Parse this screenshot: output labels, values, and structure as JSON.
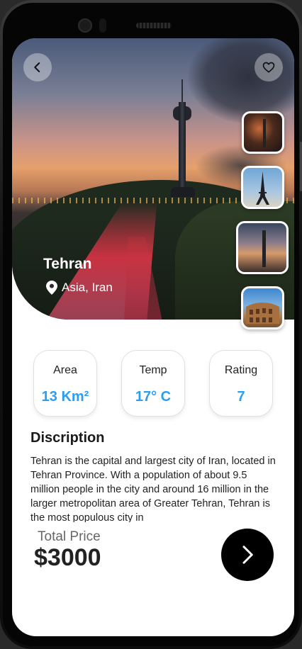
{
  "destination": {
    "name": "Tehran",
    "location": "Asia, Iran"
  },
  "header": {
    "back_icon": "chevron-left-icon",
    "favorite_icon": "heart-outline-icon"
  },
  "gallery": {
    "thumbnails": [
      "city-night-thumbnail",
      "eiffel-tower-thumbnail",
      "milad-tower-thumbnail",
      "colosseum-thumbnail"
    ]
  },
  "stats": [
    {
      "label": "Area",
      "value": "13 Km²"
    },
    {
      "label": "Temp",
      "value": "17° C"
    },
    {
      "label": "Rating",
      "value": "7"
    }
  ],
  "description": {
    "title": "Discription",
    "text": "Tehran is the capital and largest city of Iran, located in Tehran Province. With a population of about 9.5 million people in the city and around 16 million in the larger metropolitan area of Greater Tehran, Tehran is the most populous city in"
  },
  "price": {
    "label": "Total Price",
    "value": "$3000"
  },
  "colors": {
    "accent": "#2a9df4",
    "button": "#000000"
  }
}
